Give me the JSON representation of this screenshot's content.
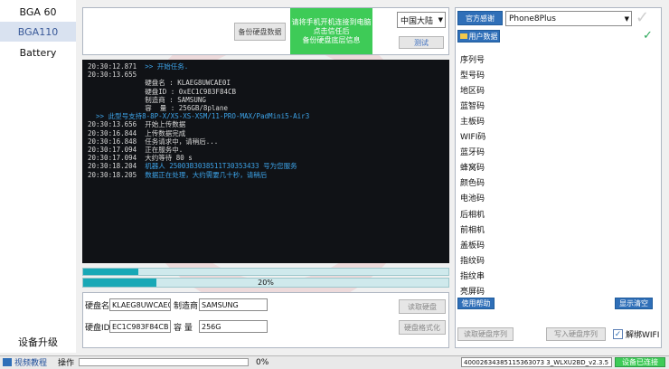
{
  "nav": {
    "items": [
      {
        "label": "BGA 60",
        "active": false
      },
      {
        "label": "BGA110",
        "active": true
      },
      {
        "label": "Battery",
        "active": false
      }
    ],
    "bottom_label": "设备升级"
  },
  "top": {
    "backup_button": "备份硬盘数据",
    "green_lines": [
      "请将手机开机连接到电脑",
      "点击信任后",
      "备份硬盘底层信息"
    ],
    "region_select": "中国大陆",
    "test_button": "测试"
  },
  "console": {
    "lines": [
      {
        "text": "20:30:12.871  >> 开始任务.",
        "style": "mixed",
        "time": "20:30:12.871",
        "rest": "  >> 开始任务."
      },
      {
        "text": "20:30:13.655",
        "style": "plain"
      },
      {
        "text": "              硬盘名 : KLAEG8UWCAE0I",
        "style": "plain"
      },
      {
        "text": "              硬盘ID : 0xEC1C983F84CB",
        "style": "plain"
      },
      {
        "text": "              制造商 : SAMSUNG",
        "style": "plain"
      },
      {
        "text": "              容  量 : 256GB/8plane",
        "style": "plain"
      },
      {
        "text": "  >> 此型号支持8-8P-X/XS-XS-XSM/11-PRO-MAX/PadMini5-Air3",
        "style": "blue"
      },
      {
        "text": "20:30:13.656  开始上传数据",
        "style": "plain"
      },
      {
        "text": "20:30:16.844  上传数据完成",
        "style": "plain"
      },
      {
        "text": "20:30:16.848  任务请求中，请稍后...",
        "style": "plain"
      },
      {
        "text": "20:30:17.094  正在服务中.",
        "style": "plain"
      },
      {
        "text": "20:30:17.094  大约等待 80 s",
        "style": "plain"
      },
      {
        "text": "20:30:18.204  机器人 25003B3038511T30353433 号为您服务",
        "style": "mixed",
        "time": "20:30:18.204",
        "rest": "  机器人 25003B3038511T30353433 号为您服务"
      },
      {
        "text": "20:30:18.205  数据正在处理，大约需要几十秒，请稍后",
        "style": "mixed",
        "time": "20:30:18.205",
        "rest": "  数据正在处理，大约需要几十秒，请稍后"
      }
    ]
  },
  "progress": {
    "bar1": 0.15,
    "bar2": 0.2,
    "bar2_label": "20%"
  },
  "info": {
    "disk_name_label": "硬盘名",
    "disk_name_value": "KLAEG8UWCAE0I",
    "maker_label": "制造商",
    "maker_value": "SAMSUNG",
    "read_disk_button": "读取硬盘",
    "disk_id_label": "硬盘ID",
    "disk_id_value": "EC1C983F84CB",
    "capacity_label": "容 量",
    "capacity_value": "256G",
    "format_button": "硬盘格式化"
  },
  "right": {
    "official_button": "官方感谢",
    "model_select": "Phone8Plus",
    "user_data_button": "用户数据",
    "codes": [
      "序列号",
      "型号码",
      "地区码",
      "蓝智码",
      "主板码",
      "WIFI码",
      "蓝牙码",
      "蜂窝码",
      "颜色码",
      "电池码",
      "后相机",
      "前相机",
      "盖板码",
      "指纹码",
      "指纹串",
      "亮屏码"
    ],
    "help_button": "使用帮助",
    "clear_button": "显示清空",
    "read_syscfg_button": "读取硬盘序列",
    "write_syscfg_button": "写入硬盘序列",
    "unbind_label": "解绑WIFI",
    "unbind_checked": true
  },
  "status": {
    "video_label": "视频教程",
    "op_label": "操作",
    "progress_text": "0%",
    "serial": "40002634385115363073 3_WLXU2BD_v2.3.5",
    "device_button": "设备已连接"
  },
  "colors": {
    "accent": "#2f6fb8",
    "green": "#3ecb57",
    "teal": "#18a8b6"
  }
}
